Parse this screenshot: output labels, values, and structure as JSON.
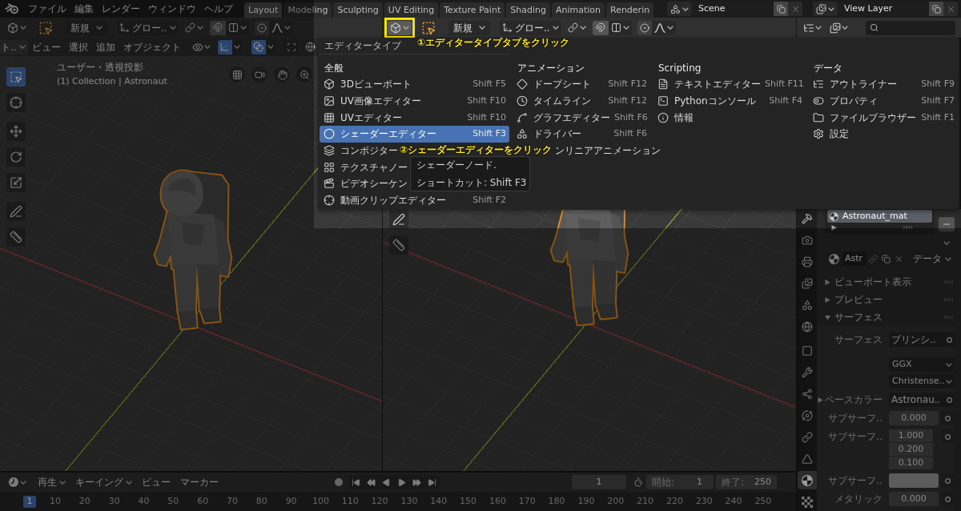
{
  "topbar": {
    "menus": [
      "ファイル",
      "編集",
      "レンダー",
      "ウィンドウ",
      "ヘルプ"
    ],
    "workspaces": [
      {
        "label": "Layout",
        "selected": true
      },
      {
        "label": "Modeling",
        "selected": false
      },
      {
        "label": "Sculpting",
        "selected": false
      },
      {
        "label": "UV Editing",
        "selected": false
      },
      {
        "label": "Texture Paint",
        "selected": false
      },
      {
        "label": "Shading",
        "selected": false
      },
      {
        "label": "Animation",
        "selected": false
      },
      {
        "label": "Renderin",
        "selected": false
      }
    ],
    "scene": "Scene",
    "view_layer": "View Layer"
  },
  "viewports": [
    {
      "highlighted": false,
      "mode": "新規",
      "orientation": "グロー..",
      "object_mode": "ト..",
      "menus": [
        "ビュー",
        "選択",
        "追加",
        "オブジェクト"
      ],
      "view_name": "ユーザー・透視投影",
      "collection": "(1) Collection | Astronaut",
      "tools": [
        {
          "kind": "select",
          "selected": true
        },
        {
          "kind": "cursor",
          "selected": false
        },
        {
          "kind": "move",
          "selected": false
        },
        {
          "kind": "rotate",
          "selected": false
        },
        {
          "kind": "scale",
          "selected": false
        },
        {
          "kind": "annotate",
          "selected": false
        },
        {
          "kind": "measure",
          "selected": false
        }
      ]
    },
    {
      "highlighted": true,
      "mode": "新規",
      "orientation": "グロー..",
      "tools": [
        {
          "kind": "annotate",
          "selected": false
        },
        {
          "kind": "measure",
          "selected": false
        }
      ]
    }
  ],
  "editor_menu": {
    "title": "エディタータイプ",
    "columns": [
      {
        "heading": "全般",
        "items": [
          {
            "kind": "viewport3d",
            "label": "3Dビューポート",
            "shortcut": "Shift F5",
            "selected": false
          },
          {
            "kind": "uv_image",
            "label": "UV画像エディター",
            "shortcut": "Shift F10",
            "selected": false
          },
          {
            "kind": "uv",
            "label": "UVエディター",
            "shortcut": "Shift F10",
            "selected": false
          },
          {
            "kind": "shader",
            "label": "シェーダーエディター",
            "shortcut": "Shift F3",
            "selected": true
          },
          {
            "kind": "compositor",
            "label": "コンポジター",
            "selected": false
          },
          {
            "kind": "texture_node",
            "label": "テクスチャノー",
            "selected": false
          },
          {
            "kind": "sequencer",
            "label": "ビデオシーケン",
            "selected": false
          },
          {
            "kind": "clip",
            "label": "動画クリップエディター",
            "shortcut": "Shift F2",
            "selected": false
          }
        ]
      },
      {
        "heading": "アニメーション",
        "items": [
          {
            "kind": "dopesheet",
            "label": "ドープシート",
            "shortcut": "Shift F12",
            "selected": false
          },
          {
            "kind": "timeline",
            "label": "タイムライン",
            "shortcut": "Shift F12",
            "selected": false
          },
          {
            "kind": "graph",
            "label": "グラフエディター",
            "shortcut": "Shift F6",
            "selected": false
          },
          {
            "kind": "driver",
            "label": "ドライバー",
            "shortcut": "Shift F6",
            "selected": false
          },
          {
            "label": "ンリニアアニメーション",
            "selected": false
          }
        ]
      },
      {
        "heading": "Scripting",
        "items": [
          {
            "kind": "text",
            "label": "テキストエディター",
            "shortcut": "Shift F11",
            "selected": false
          },
          {
            "kind": "console",
            "label": "Pythonコンソール",
            "shortcut": "Shift F4",
            "selected": false
          },
          {
            "kind": "info",
            "label": "情報",
            "selected": false
          }
        ]
      },
      {
        "heading": "データ",
        "items": [
          {
            "kind": "outliner",
            "label": "アウトライナー",
            "shortcut": "Shift F9",
            "selected": false
          },
          {
            "kind": "properties",
            "label": "プロパティ",
            "shortcut": "Shift F7",
            "selected": false
          },
          {
            "kind": "file_browser",
            "label": "ファイルブラウザー",
            "shortcut": "Shift F1",
            "selected": false
          },
          {
            "kind": "preferences",
            "label": "設定",
            "selected": false
          }
        ]
      }
    ]
  },
  "tooltip": [
    "シェーダーノード.",
    "ショートカット: Shift F3"
  ],
  "annotations": [
    "①エディタータイプタブをクリック",
    "②シェーダーエディターをクリック"
  ],
  "properties": {
    "tabs": [
      {
        "kind": "tool",
        "selected": false
      },
      {
        "kind": "render",
        "selected": false
      },
      {
        "kind": "output",
        "selected": false
      },
      {
        "kind": "view_layer",
        "selected": false
      },
      {
        "kind": "scene",
        "selected": false
      },
      {
        "kind": "world",
        "selected": false
      },
      {
        "kind": "object",
        "selected": false
      },
      {
        "kind": "modifier",
        "selected": false
      },
      {
        "kind": "particles",
        "selected": false
      },
      {
        "kind": "physics",
        "selected": false
      },
      {
        "kind": "constraints",
        "selected": false
      },
      {
        "kind": "data",
        "selected": false
      },
      {
        "kind": "material",
        "selected": true
      },
      {
        "kind": "texture",
        "selected": false
      }
    ],
    "material_slots": [
      {
        "name": "Astronaut_mat",
        "selected": true
      }
    ],
    "material": {
      "name": "Astr",
      "link": "データ"
    },
    "panels": [
      {
        "label": "ビューポート表示",
        "expanded": false
      },
      {
        "label": "プレビュー",
        "expanded": false
      },
      {
        "label": "サーフェス",
        "expanded": true
      }
    ],
    "fields": [
      {
        "kind": "link",
        "label": "サーフェス",
        "value": "プリンシ.."
      },
      {
        "kind": "dropdown",
        "value": "GGX"
      },
      {
        "kind": "dropdown",
        "value": "Christense.."
      },
      {
        "kind": "link",
        "label": "ベースカラー",
        "value": "Astronau..",
        "expanded": false
      },
      {
        "kind": "number",
        "label": "サブサーフ..",
        "value": "0.000"
      },
      {
        "kind": "vector",
        "label": "サブサーフ..",
        "values": [
          "1.000",
          "0.200",
          "0.100"
        ]
      },
      {
        "kind": "color",
        "label": "サブサーフ.."
      },
      {
        "kind": "number",
        "label": "メタリック",
        "value": "0.000"
      }
    ]
  },
  "timeline": {
    "menus": [
      {
        "label": "再生",
        "dropdown": true
      },
      {
        "label": "キーイング",
        "dropdown": true
      },
      {
        "label": "ビュー",
        "dropdown": false
      },
      {
        "label": "マーカー",
        "dropdown": false
      }
    ],
    "current_frame": "1",
    "start_label": "開始:",
    "start": "1",
    "end_label": "終了:",
    "end": "250",
    "frames": [
      {
        "label": "1",
        "selected": true
      },
      {
        "label": "10",
        "selected": false
      },
      {
        "label": "20",
        "selected": false
      },
      {
        "label": "30",
        "selected": false
      },
      {
        "label": "40",
        "selected": false
      },
      {
        "label": "50",
        "selected": false
      },
      {
        "label": "60",
        "selected": false
      },
      {
        "label": "70",
        "selected": false
      },
      {
        "label": "80",
        "selected": false
      },
      {
        "label": "90",
        "selected": false
      },
      {
        "label": "100",
        "selected": false
      },
      {
        "label": "110",
        "selected": false
      },
      {
        "label": "120",
        "selected": false
      },
      {
        "label": "130",
        "selected": false
      },
      {
        "label": "140",
        "selected": false
      },
      {
        "label": "150",
        "selected": false
      },
      {
        "label": "160",
        "selected": false
      },
      {
        "label": "170",
        "selected": false
      },
      {
        "label": "180",
        "selected": false
      },
      {
        "label": "190",
        "selected": false
      },
      {
        "label": "200",
        "selected": false
      },
      {
        "label": "210",
        "selected": false
      },
      {
        "label": "220",
        "selected": false
      },
      {
        "label": "230",
        "selected": false
      },
      {
        "label": "240",
        "selected": false
      },
      {
        "label": "250",
        "selected": false
      }
    ]
  }
}
